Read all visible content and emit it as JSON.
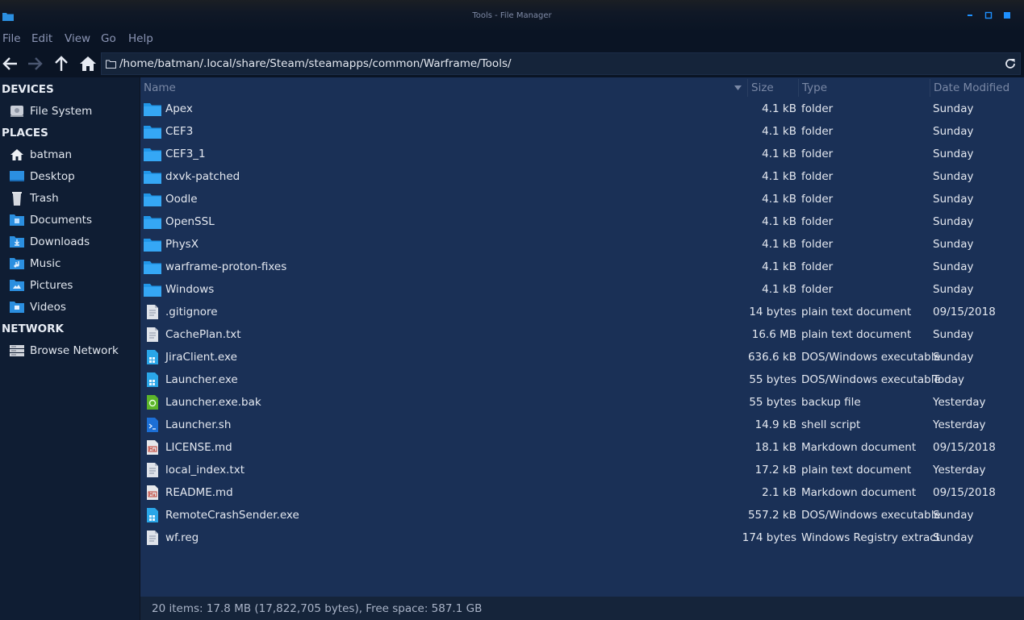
{
  "window": {
    "title": "Tools - File Manager"
  },
  "menu": [
    "File",
    "Edit",
    "View",
    "Go",
    "Help"
  ],
  "location": {
    "path": "/home/batman/.local/share/Steam/steamapps/common/Warframe/Tools/"
  },
  "sidebar": {
    "devices_header": "DEVICES",
    "devices": [
      {
        "label": "File System",
        "icon": "drive-icon"
      }
    ],
    "places_header": "PLACES",
    "places": [
      {
        "label": "batman",
        "icon": "home-icon"
      },
      {
        "label": "Desktop",
        "icon": "desktop-icon"
      },
      {
        "label": "Trash",
        "icon": "trash-icon"
      },
      {
        "label": "Documents",
        "icon": "documents-folder-icon"
      },
      {
        "label": "Downloads",
        "icon": "downloads-folder-icon"
      },
      {
        "label": "Music",
        "icon": "music-folder-icon"
      },
      {
        "label": "Pictures",
        "icon": "pictures-folder-icon"
      },
      {
        "label": "Videos",
        "icon": "videos-folder-icon"
      }
    ],
    "network_header": "NETWORK",
    "network": [
      {
        "label": "Browse Network",
        "icon": "network-icon"
      }
    ]
  },
  "columns": {
    "name": "Name",
    "size": "Size",
    "type": "Type",
    "date": "Date Modified"
  },
  "files": [
    {
      "name": "Apex",
      "size": "4.1 kB",
      "type": "folder",
      "date": "Sunday",
      "icon": "folder"
    },
    {
      "name": "CEF3",
      "size": "4.1 kB",
      "type": "folder",
      "date": "Sunday",
      "icon": "folder"
    },
    {
      "name": "CEF3_1",
      "size": "4.1 kB",
      "type": "folder",
      "date": "Sunday",
      "icon": "folder"
    },
    {
      "name": "dxvk-patched",
      "size": "4.1 kB",
      "type": "folder",
      "date": "Sunday",
      "icon": "folder"
    },
    {
      "name": "Oodle",
      "size": "4.1 kB",
      "type": "folder",
      "date": "Sunday",
      "icon": "folder"
    },
    {
      "name": "OpenSSL",
      "size": "4.1 kB",
      "type": "folder",
      "date": "Sunday",
      "icon": "folder"
    },
    {
      "name": "PhysX",
      "size": "4.1 kB",
      "type": "folder",
      "date": "Sunday",
      "icon": "folder"
    },
    {
      "name": "warframe-proton-fixes",
      "size": "4.1 kB",
      "type": "folder",
      "date": "Sunday",
      "icon": "folder"
    },
    {
      "name": "Windows",
      "size": "4.1 kB",
      "type": "folder",
      "date": "Sunday",
      "icon": "folder"
    },
    {
      "name": ".gitignore",
      "size": "14 bytes",
      "type": "plain text document",
      "date": "09/15/2018",
      "icon": "text"
    },
    {
      "name": "CachePlan.txt",
      "size": "16.6 MB",
      "type": "plain text document",
      "date": "Sunday",
      "icon": "text"
    },
    {
      "name": "JiraClient.exe",
      "size": "636.6 kB",
      "type": "DOS/Windows executable",
      "date": "Sunday",
      "icon": "exe"
    },
    {
      "name": "Launcher.exe",
      "size": "55 bytes",
      "type": "DOS/Windows executable",
      "date": "Today",
      "icon": "exe"
    },
    {
      "name": "Launcher.exe.bak",
      "size": "55 bytes",
      "type": "backup file",
      "date": "Yesterday",
      "icon": "backup"
    },
    {
      "name": "Launcher.sh",
      "size": "14.9 kB",
      "type": "shell script",
      "date": "Yesterday",
      "icon": "script"
    },
    {
      "name": "LICENSE.md",
      "size": "18.1 kB",
      "type": "Markdown document",
      "date": "09/15/2018",
      "icon": "markdown"
    },
    {
      "name": "local_index.txt",
      "size": "17.2 kB",
      "type": "plain text document",
      "date": "Yesterday",
      "icon": "text"
    },
    {
      "name": "README.md",
      "size": "2.1 kB",
      "type": "Markdown document",
      "date": "09/15/2018",
      "icon": "markdown"
    },
    {
      "name": "RemoteCrashSender.exe",
      "size": "557.2 kB",
      "type": "DOS/Windows executable",
      "date": "Sunday",
      "icon": "exe"
    },
    {
      "name": "wf.reg",
      "size": "174 bytes",
      "type": "Windows Registry extract",
      "date": "Sunday",
      "icon": "text"
    }
  ],
  "status": "20 items: 17.8 MB (17,822,705 bytes), Free space: 587.1 GB",
  "colors": {
    "accent": "#2b8fe0",
    "background": "#1a3056",
    "sidebar": "#0f1d33",
    "bar": "#0a1424"
  }
}
